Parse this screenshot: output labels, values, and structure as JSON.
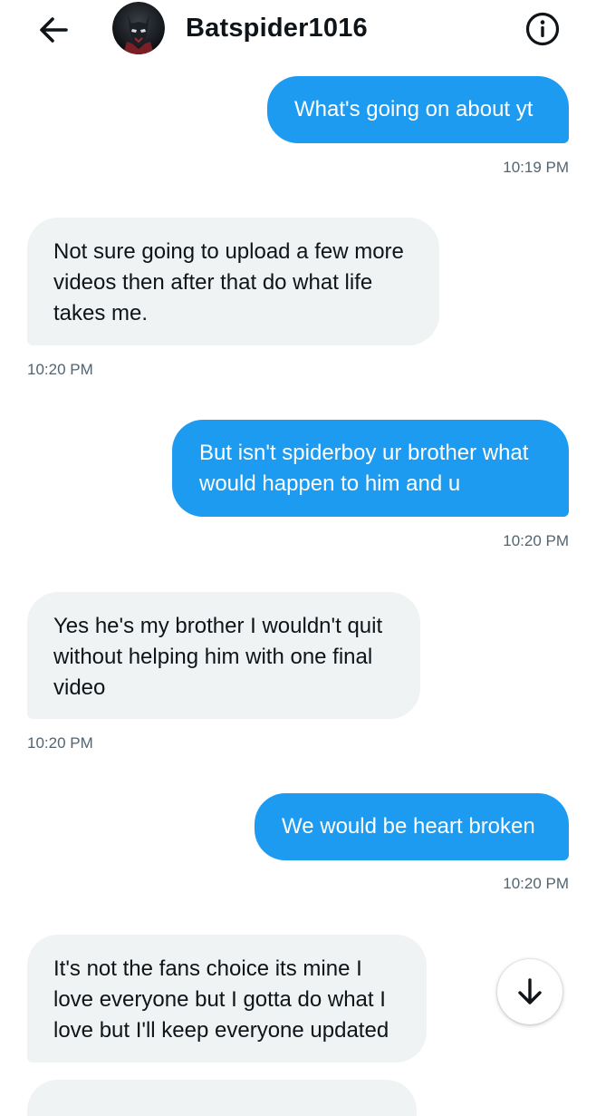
{
  "header": {
    "title": "Batspider1016",
    "back_icon": "arrow-left-icon",
    "info_icon": "info-icon",
    "avatar_icon": "profile-avatar"
  },
  "messages": [
    {
      "side": "sent",
      "text": "What's going on about yt",
      "time": "10:19 PM"
    },
    {
      "side": "received",
      "text": "Not sure going to upload a few more videos then after that do what life takes me.",
      "time": "10:20 PM"
    },
    {
      "side": "sent",
      "text": "But isn't spiderboy ur brother what would happen to him and u",
      "time": "10:20 PM"
    },
    {
      "side": "received",
      "text": "Yes he's my brother I wouldn't quit without helping him with one final video",
      "time": "10:20 PM"
    },
    {
      "side": "sent",
      "text": "We would be heart broken",
      "time": "10:20 PM"
    },
    {
      "side": "received",
      "text": "It's not the fans choice its mine I love everyone but I gotta do what I love but I'll keep everyone updated",
      "time": ""
    }
  ],
  "scroll_button": {
    "icon": "arrow-down-icon"
  },
  "colors": {
    "sent_bubble": "#1d9bf0",
    "received_bubble": "#eff3f4",
    "timestamp": "#536471",
    "text": "#0f1419"
  }
}
